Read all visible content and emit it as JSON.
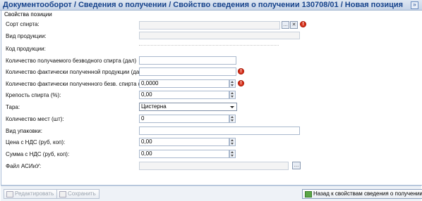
{
  "title": "Документооборот  / Сведения о получении / Свойство сведения о получении 130708/01 / Новая позиция",
  "titlebar_button": "»",
  "section_title": "Свойства позиции",
  "fields": {
    "sort_label": "Сорт спирта:",
    "product_type_label": "Вид продукции:",
    "product_code_label": "Код продукции:",
    "qty_anhydrous_label": "Количество получаемого безводного спирта (дал)",
    "qty_received_label": "Количество фактически полученной продукции (дал):",
    "qty_received_anhydrous_label": "Количество фактически полученного безв. спирта (дал):",
    "qty_received_anhydrous_value": "0,0000",
    "strength_label": "Крепость спирта (%):",
    "strength_value": "0,00",
    "container_label": "Тара:",
    "container_value": "Цистерна",
    "places_label": "Количество мест (шт):",
    "places_value": "0",
    "packaging_label": "Вид упаковки:",
    "price_label": "Цена с НДС (руб, коп):",
    "price_value": "0,00",
    "sum_label": "Сумма с НДС (руб, коп):",
    "sum_value": "0,00",
    "file_label": "Файл АСИиУ:"
  },
  "icons": {
    "browse": "…",
    "clear": "✕",
    "error": "!"
  },
  "footer": {
    "edit_label": "Редактировать",
    "save_label": "Сохранить",
    "back_label": "Назад к свойствам сведения о получении"
  }
}
